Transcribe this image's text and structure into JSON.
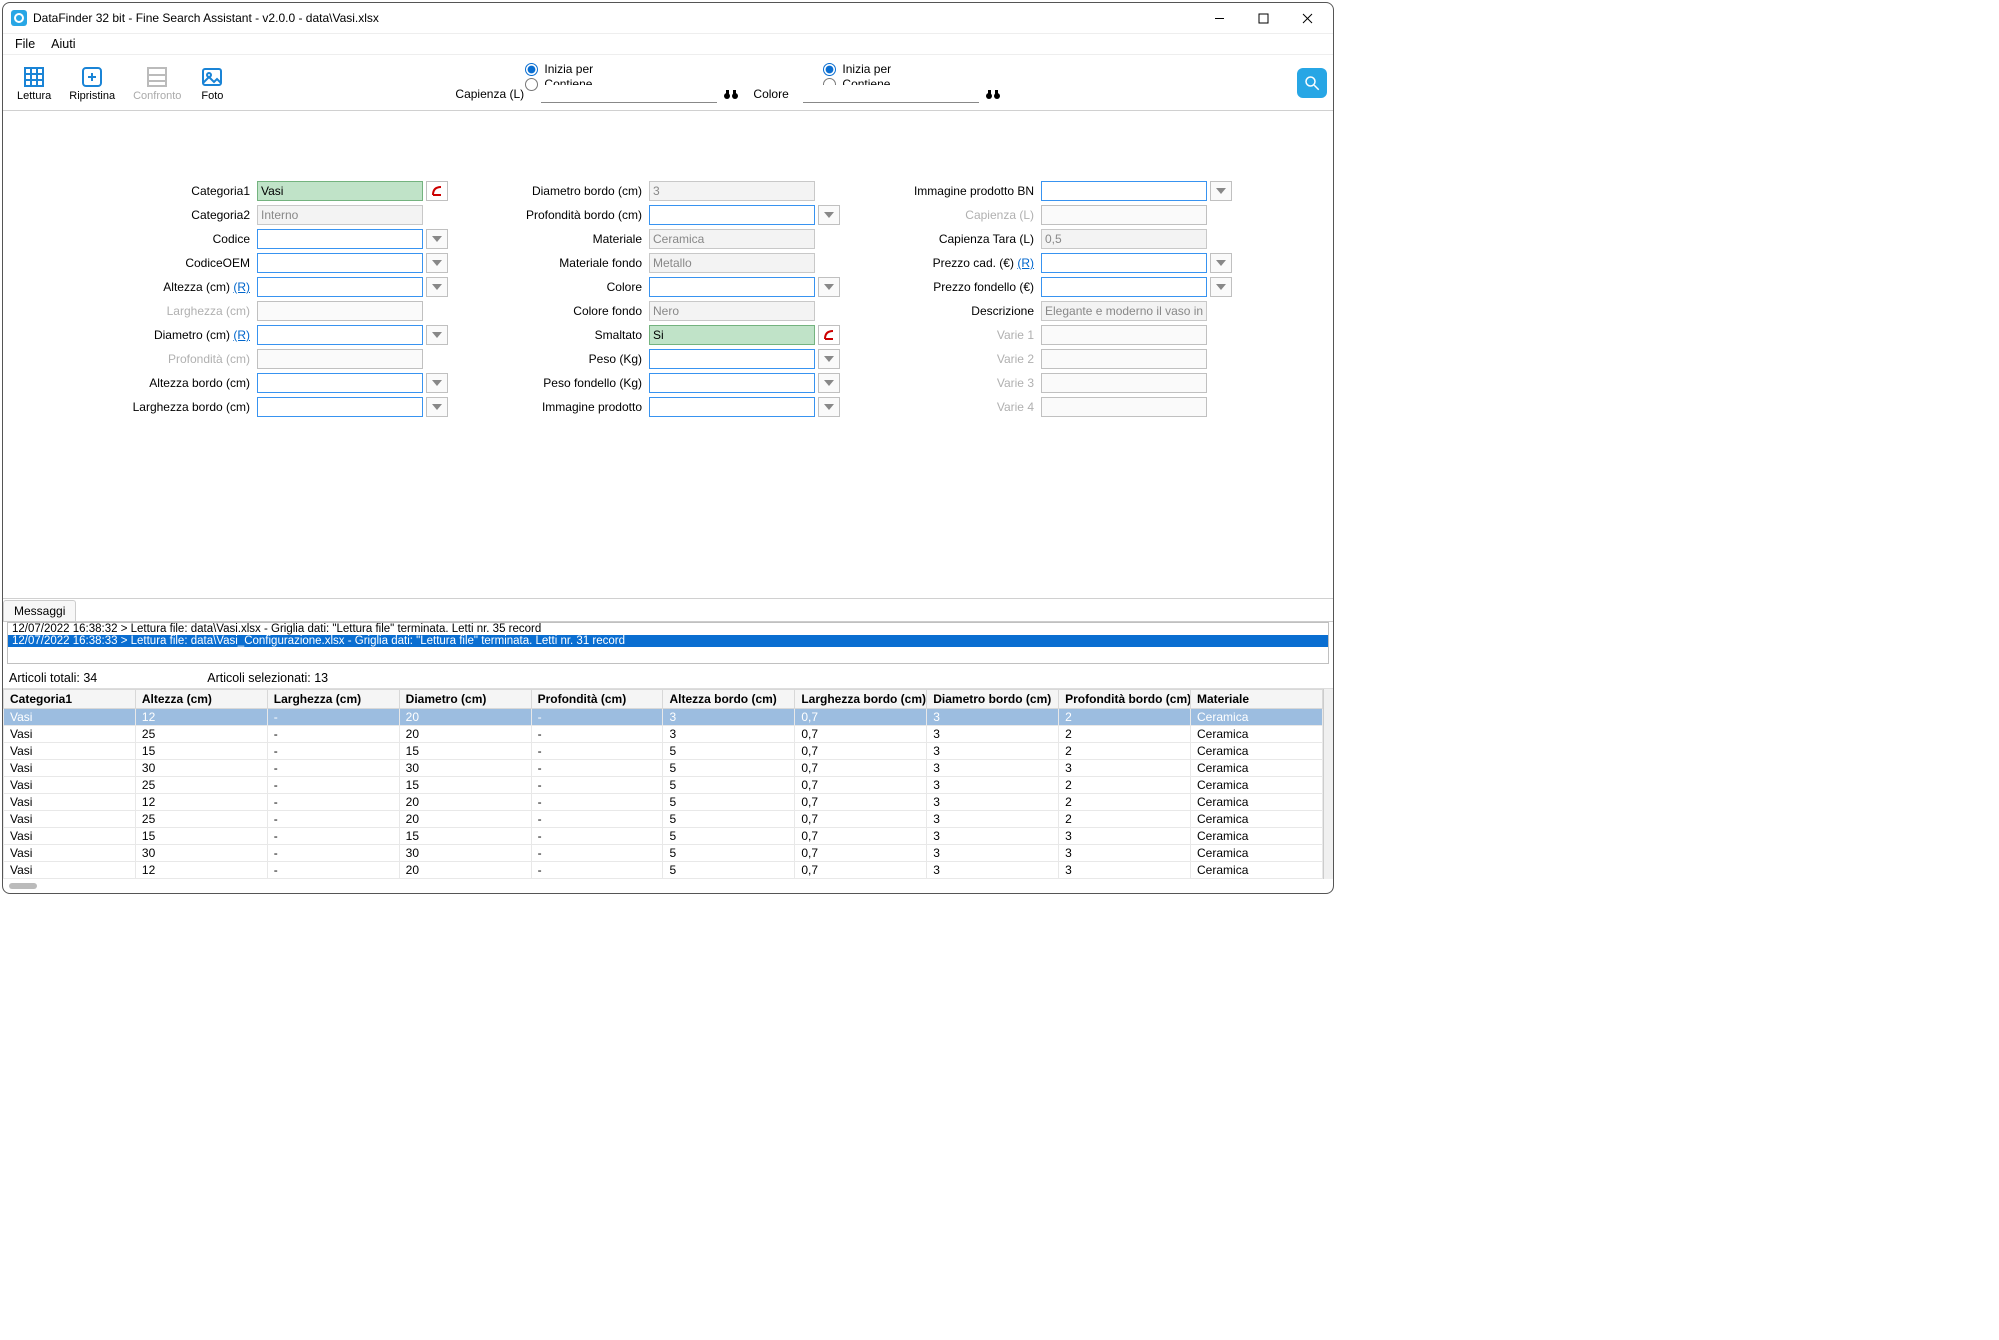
{
  "window": {
    "title": "DataFinder 32 bit - Fine Search Assistant - v2.0.0 - data\\Vasi.xlsx"
  },
  "menu": {
    "file": "File",
    "help": "Aiuti"
  },
  "toolbar": {
    "read": "Lettura",
    "restore": "Ripristina",
    "compare": "Confronto",
    "photo": "Foto"
  },
  "search": {
    "labelCap": "Capienza (L)",
    "labelCol": "Colore",
    "startswith": "Inizia per",
    "contains": "Contiene"
  },
  "form": {
    "col1": {
      "categoria1": {
        "label": "Categoria1",
        "value": "Vasi"
      },
      "categoria2": {
        "label": "Categoria2",
        "value": "Interno"
      },
      "codice": {
        "label": "Codice",
        "value": ""
      },
      "codiceoem": {
        "label": "CodiceOEM",
        "value": ""
      },
      "altezza": {
        "label": "Altezza (cm)",
        "r": "(R)",
        "value": ""
      },
      "larghezza": {
        "label": "Larghezza (cm)",
        "value": ""
      },
      "diametro": {
        "label": "Diametro (cm)",
        "r": "(R)",
        "value": ""
      },
      "profondita": {
        "label": "Profondità (cm)",
        "value": ""
      },
      "altezzabordo": {
        "label": "Altezza bordo (cm)",
        "value": ""
      },
      "larghezzabordo": {
        "label": "Larghezza bordo (cm)",
        "value": ""
      }
    },
    "col2": {
      "diambordo": {
        "label": "Diametro bordo (cm)",
        "value": "3"
      },
      "profbordo": {
        "label": "Profondità bordo (cm)",
        "value": ""
      },
      "materiale": {
        "label": "Materiale",
        "value": "Ceramica"
      },
      "materialefondo": {
        "label": "Materiale fondo",
        "value": "Metallo"
      },
      "colore": {
        "label": "Colore",
        "value": ""
      },
      "colorefondo": {
        "label": "Colore fondo",
        "value": "Nero"
      },
      "smaltato": {
        "label": "Smaltato",
        "value": "Si"
      },
      "peso": {
        "label": "Peso (Kg)",
        "value": ""
      },
      "pesofond": {
        "label": "Peso fondello (Kg)",
        "value": ""
      },
      "imgprod": {
        "label": "Immagine prodotto",
        "value": ""
      }
    },
    "col3": {
      "imgbn": {
        "label": "Immagine prodotto BN",
        "value": ""
      },
      "cap": {
        "label": "Capienza (L)",
        "value": ""
      },
      "captara": {
        "label": "Capienza Tara (L)",
        "value": "0,5"
      },
      "prezzocad": {
        "label": "Prezzo cad. (€)",
        "r": "(R)",
        "value": ""
      },
      "prezzofond": {
        "label": "Prezzo fondello (€)",
        "value": ""
      },
      "descr": {
        "label": "Descrizione",
        "value": "Elegante e moderno il vaso in cer"
      },
      "var1": {
        "label": "Varie 1",
        "value": ""
      },
      "var2": {
        "label": "Varie 2",
        "value": ""
      },
      "var3": {
        "label": "Varie 3",
        "value": ""
      },
      "var4": {
        "label": "Varie 4",
        "value": ""
      }
    }
  },
  "messages": {
    "tab": "Messaggi",
    "lines": [
      "12/07/2022 16:38:32 > Lettura file: data\\Vasi.xlsx - Griglia dati: \"Lettura file\" terminata. Letti nr. 35 record",
      "12/07/2022 16:38:33 > Lettura file: data\\Vasi_Configurazione.xlsx - Griglia dati: \"Lettura file\" terminata. Letti nr. 31 record"
    ]
  },
  "status": {
    "total": "Articoli totali: 34",
    "selected": "Articoli selezionati: 13"
  },
  "grid": {
    "columns": [
      "Categoria1",
      "Altezza (cm)",
      "Larghezza (cm)",
      "Diametro (cm)",
      "Profondità (cm)",
      "Altezza bordo (cm)",
      "Larghezza bordo (cm)",
      "Diametro bordo (cm)",
      "Profondità bordo (cm)",
      "Materiale"
    ],
    "rows": [
      [
        "Vasi",
        "12",
        "-",
        "20",
        "-",
        "3",
        "0,7",
        "3",
        "2",
        "Ceramica"
      ],
      [
        "Vasi",
        "25",
        "-",
        "20",
        "-",
        "3",
        "0,7",
        "3",
        "2",
        "Ceramica"
      ],
      [
        "Vasi",
        "15",
        "-",
        "15",
        "-",
        "5",
        "0,7",
        "3",
        "2",
        "Ceramica"
      ],
      [
        "Vasi",
        "30",
        "-",
        "30",
        "-",
        "5",
        "0,7",
        "3",
        "3",
        "Ceramica"
      ],
      [
        "Vasi",
        "25",
        "-",
        "15",
        "-",
        "5",
        "0,7",
        "3",
        "2",
        "Ceramica"
      ],
      [
        "Vasi",
        "12",
        "-",
        "20",
        "-",
        "5",
        "0,7",
        "3",
        "2",
        "Ceramica"
      ],
      [
        "Vasi",
        "25",
        "-",
        "20",
        "-",
        "5",
        "0,7",
        "3",
        "2",
        "Ceramica"
      ],
      [
        "Vasi",
        "15",
        "-",
        "15",
        "-",
        "5",
        "0,7",
        "3",
        "3",
        "Ceramica"
      ],
      [
        "Vasi",
        "30",
        "-",
        "30",
        "-",
        "5",
        "0,7",
        "3",
        "3",
        "Ceramica"
      ],
      [
        "Vasi",
        "12",
        "-",
        "20",
        "-",
        "5",
        "0,7",
        "3",
        "3",
        "Ceramica"
      ]
    ]
  }
}
